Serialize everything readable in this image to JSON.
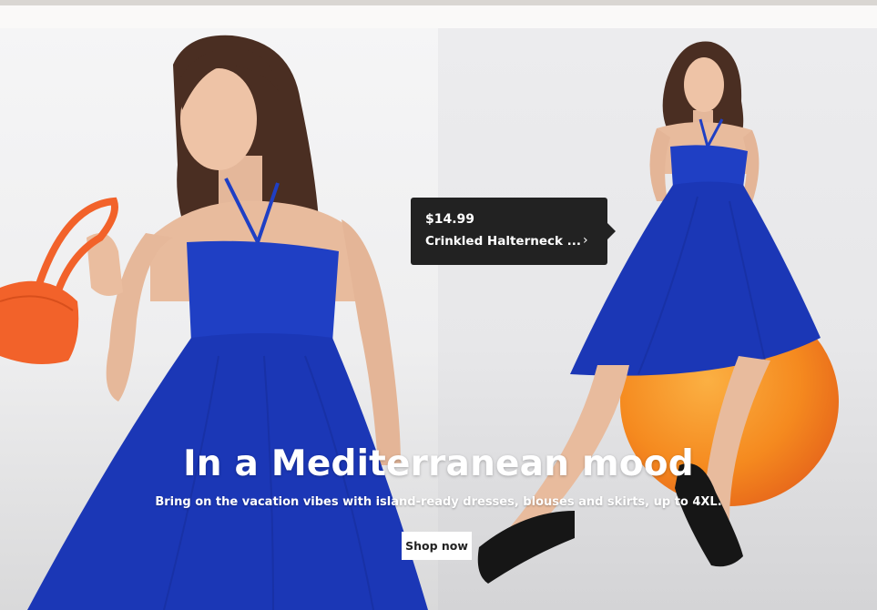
{
  "hero": {
    "headline": "In a Mediterranean mood",
    "subline": "Bring on the vacation vibes with island-ready dresses, blouses and skirts, up to 4XL.",
    "cta_label": "Shop now"
  },
  "price_tag": {
    "price": "$14.99",
    "product_name": "Crinkled Halterneck ...",
    "chevron": "›"
  },
  "colors": {
    "dress_blue": "#1f3fc4",
    "bag_orange": "#f2622a",
    "ball_orange": "#f7931e",
    "tag_background": "#222222"
  }
}
